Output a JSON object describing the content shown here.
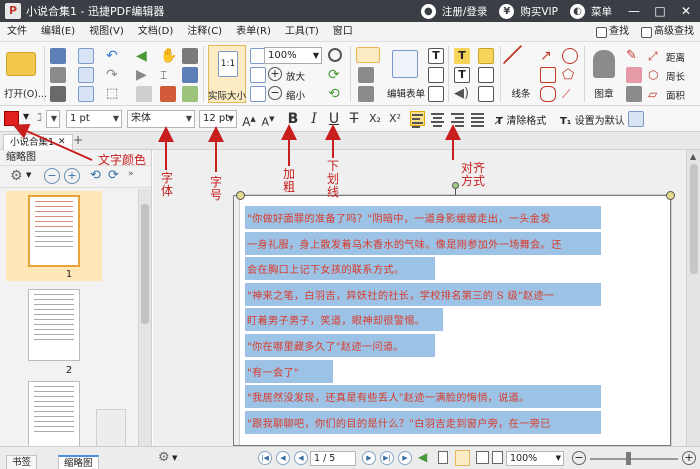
{
  "titlebar": {
    "title": "小说合集1 - 迅捷PDF编辑器",
    "login": "注册/登录",
    "vip": "购买VIP",
    "menu": "菜单",
    "logo_letter": "P"
  },
  "menubar": {
    "items": [
      "文件",
      "编辑(E)",
      "视图(V)",
      "文档(D)",
      "注释(C)",
      "表单(R)",
      "工具(T)",
      "窗口"
    ],
    "right_items": [
      "查找",
      "高级查找"
    ]
  },
  "ribbon": {
    "open_label": "打开(O)...",
    "actual_size_label": "实际大小",
    "zoom_value": "100%",
    "zoom_in_label": "放大",
    "zoom_out_label": "缩小",
    "edit_form_label": "编辑表单",
    "line_label": "线条",
    "stamp_label": "图章",
    "distance_label": "距离",
    "perimeter_label": "周长",
    "area_label": "面积"
  },
  "format_bar": {
    "text_color": "#e21f1f",
    "line_width": "1 pt",
    "font_name": "宋体",
    "font_size": "12 pt",
    "bold": "B",
    "italic": "I",
    "underline": "U",
    "strikethrough": "T",
    "subscript": "X₂",
    "superscript": "X²",
    "clear_format": "清除格式",
    "set_default": "设置为默认"
  },
  "tabs": {
    "doc_tab": "小说合集1"
  },
  "left_panel": {
    "title": "缩略图",
    "pages": [
      "1",
      "2"
    ]
  },
  "document": {
    "lines": [
      "\"你做好面罪的准备了吗？\"阴暗中，一道身影缓缓走出，一头金发",
      "一身礼服，身上散发着乌木香水的气味。像是刚参加外一场舞会。还",
      "会在胸口上记下女孩的联系方式。",
      "\"神来之笔，白羽吉，异妖社的社长，学校排名第三的 S 级\"赵迹一",
      "盯着男子男子，笑道，眼神却很警惕。",
      "\"你在哪里藏多久了\"赵迹一问道。",
      "\"有一会了\"",
      "\"我居然没发现，还真是有些丢人\"赵迹一满脸的悔悄，说道。",
      "\"跟我聊聊吧，你们的目的是什么？\"白羽吉走到窗户旁，在一旁已"
    ]
  },
  "annotations": {
    "text_color": "文字颜色",
    "font": "字体",
    "font_size": "字号",
    "bold": "加粗",
    "underline": "下划线",
    "align": "对齐方式"
  },
  "statusbar": {
    "bookmark_tab": "书签",
    "thumbnail_tab": "缩略图",
    "page_indicator": "1 / 5",
    "zoom": "100%"
  }
}
